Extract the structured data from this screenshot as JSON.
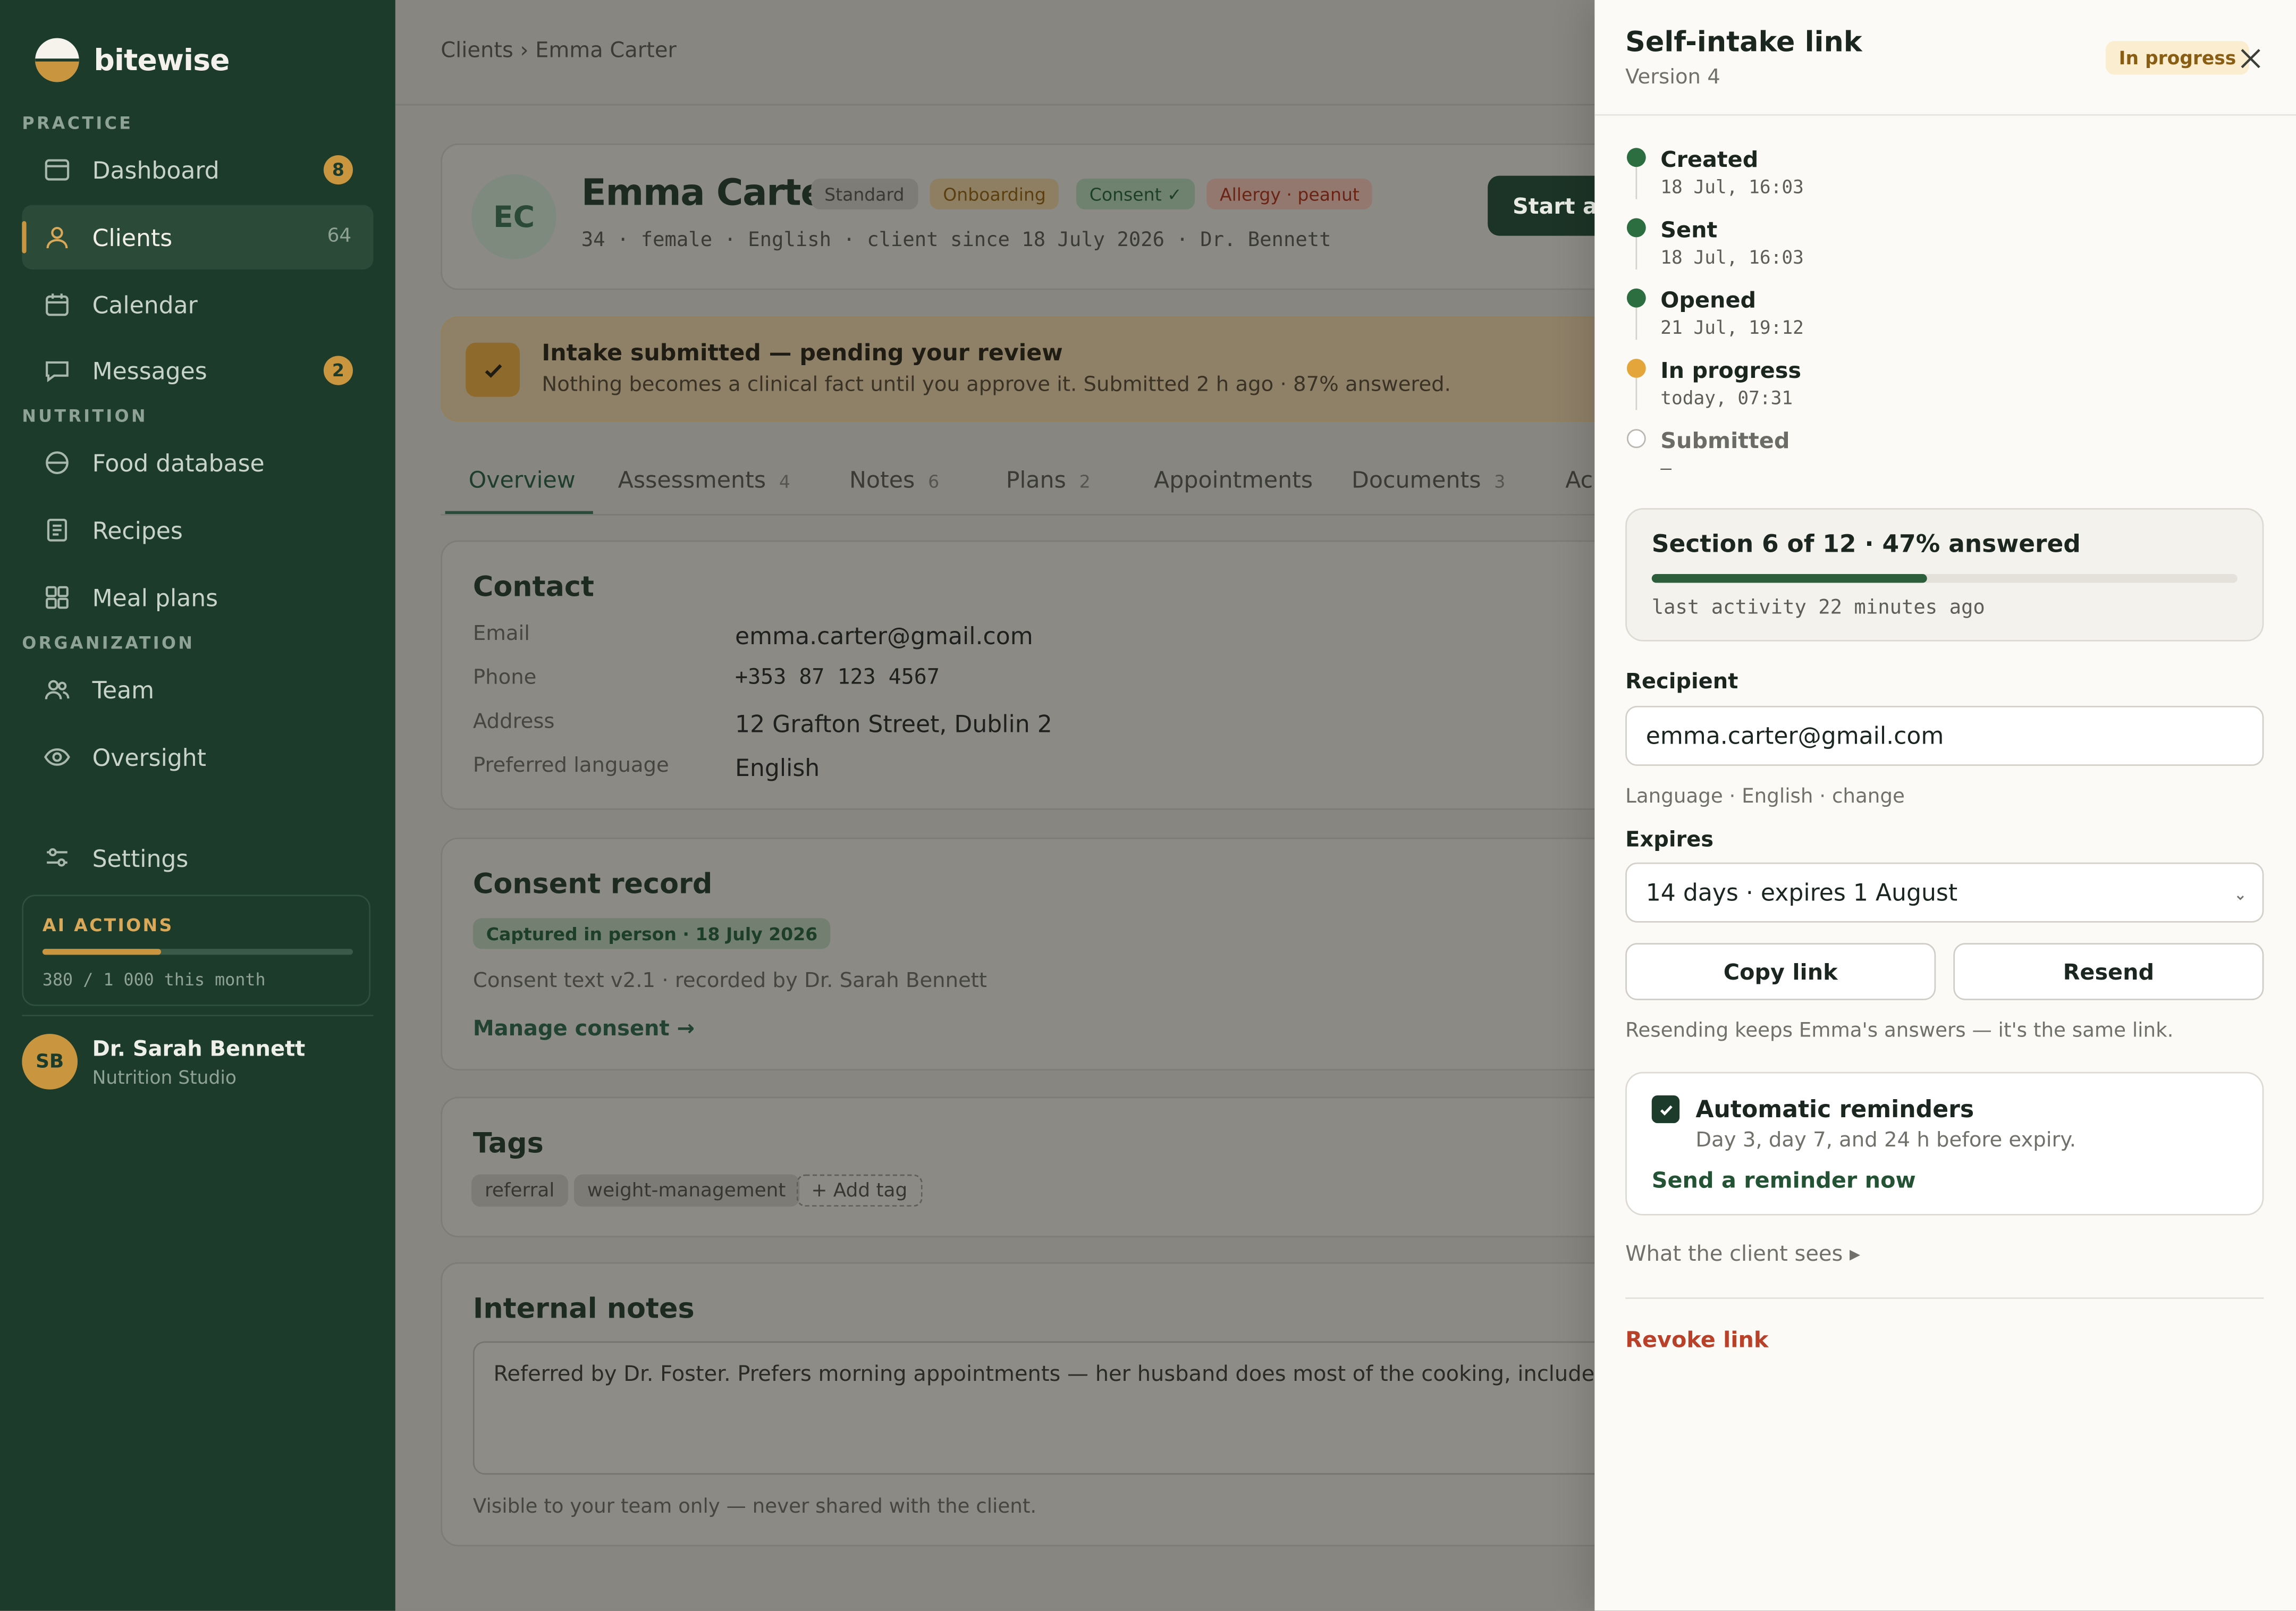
{
  "brand": {
    "name": "bitewise"
  },
  "sidebar": {
    "sections": {
      "practice": "PRACTICE",
      "nutrition": "NUTRITION",
      "organization": "ORGANIZATION"
    },
    "items": [
      {
        "label": "Dashboard",
        "icon": "dashboard-icon",
        "badge": "8"
      },
      {
        "label": "Clients",
        "icon": "user-icon",
        "count": "64",
        "active": true
      },
      {
        "label": "Calendar",
        "icon": "calendar-icon"
      },
      {
        "label": "Messages",
        "icon": "message-icon",
        "badge": "2"
      },
      {
        "label": "Food database",
        "icon": "food-icon"
      },
      {
        "label": "Recipes",
        "icon": "recipe-icon"
      },
      {
        "label": "Meal plans",
        "icon": "grid-icon"
      },
      {
        "label": "Team",
        "icon": "team-icon"
      },
      {
        "label": "Oversight",
        "icon": "eye-icon"
      },
      {
        "label": "Settings",
        "icon": "sliders-icon"
      }
    ],
    "ai": {
      "title": "AI ACTIONS",
      "usage_text": "380 / 1 000 this month",
      "used": 380,
      "limit": 1000
    },
    "user": {
      "initials": "SB",
      "name": "Dr. Sarah Bennett",
      "org": "Nutrition Studio"
    }
  },
  "breadcrumb": "Clients › Emma Carter",
  "client": {
    "initials": "EC",
    "name": "Emma Carter",
    "pills": [
      "Standard",
      "Onboarding",
      "Consent ✓",
      "Allergy · peanut"
    ],
    "meta": "34 · female · English · client since 18 July 2026 · Dr. Bennett",
    "start_button": "Start as"
  },
  "banner": {
    "title": "Intake submitted — pending your review",
    "subtitle": "Nothing becomes a clinical fact until you approve it. Submitted 2 h ago · 87% answered."
  },
  "tabs": [
    {
      "label": "Overview",
      "count": ""
    },
    {
      "label": "Assessments",
      "count": "4"
    },
    {
      "label": "Notes",
      "count": "6"
    },
    {
      "label": "Plans",
      "count": "2"
    },
    {
      "label": "Appointments",
      "count": ""
    },
    {
      "label": "Documents",
      "count": "3"
    },
    {
      "label": "Ac",
      "count": ""
    }
  ],
  "contact": {
    "title": "Contact",
    "rows": [
      {
        "key": "Email",
        "value": "emma.carter@gmail.com"
      },
      {
        "key": "Phone",
        "value": "+353 87 123 4567"
      },
      {
        "key": "Address",
        "value": "12 Grafton Street, Dublin 2"
      },
      {
        "key": "Preferred language",
        "value": "English"
      }
    ]
  },
  "consent": {
    "title": "Consent record",
    "badge": "Captured in person · 18 July 2026",
    "text": "Consent text v2.1 · recorded by Dr. Sarah Bennett",
    "link": "Manage consent →"
  },
  "tags": {
    "title": "Tags",
    "items": [
      "referral",
      "weight-management"
    ],
    "add": "+ Add tag"
  },
  "notes": {
    "title": "Internal notes",
    "text": "Referred by Dr. Foster. Prefers morning appointments — her husband does most of the cooking, include him in the plan handover.",
    "help": "Visible to your team only — never shared with the client."
  },
  "drawer": {
    "title": "Self-intake link",
    "version": "Version 4",
    "status": "In progress",
    "timeline": [
      {
        "label": "Created",
        "time": "18 Jul, 16:03",
        "state": "done"
      },
      {
        "label": "Sent",
        "time": "18 Jul, 16:03",
        "state": "done"
      },
      {
        "label": "Opened",
        "time": "21 Jul, 19:12",
        "state": "done"
      },
      {
        "label": "In progress",
        "time": "today, 07:31",
        "state": "current"
      },
      {
        "label": "Submitted",
        "time": "—",
        "state": "pending"
      }
    ],
    "progress": {
      "title": "Section 6 of 12 · 47% answered",
      "percent": 47,
      "activity": "last activity 22 minutes ago"
    },
    "recipient_label": "Recipient",
    "recipient": "emma.carter@gmail.com",
    "language_help": "Language · English · change",
    "expires_label": "Expires",
    "expires_value": "14 days · expires 1 August",
    "copy_button": "Copy link",
    "resend_button": "Resend",
    "resend_help": "Resending keeps Emma's answers — it's the same link.",
    "reminders": {
      "title": "Automatic reminders",
      "subtitle": "Day 3, day 7, and 24 h before expiry.",
      "link": "Send a reminder now",
      "checked": true
    },
    "preview_toggle": "What the client sees ▸",
    "revoke": "Revoke link"
  },
  "colors": {
    "sidebar": "#1d3b2a",
    "accent": "#c9953f",
    "primary": "#2c5e3c",
    "danger": "#b9412a",
    "status_bg": "#fbeed0"
  }
}
